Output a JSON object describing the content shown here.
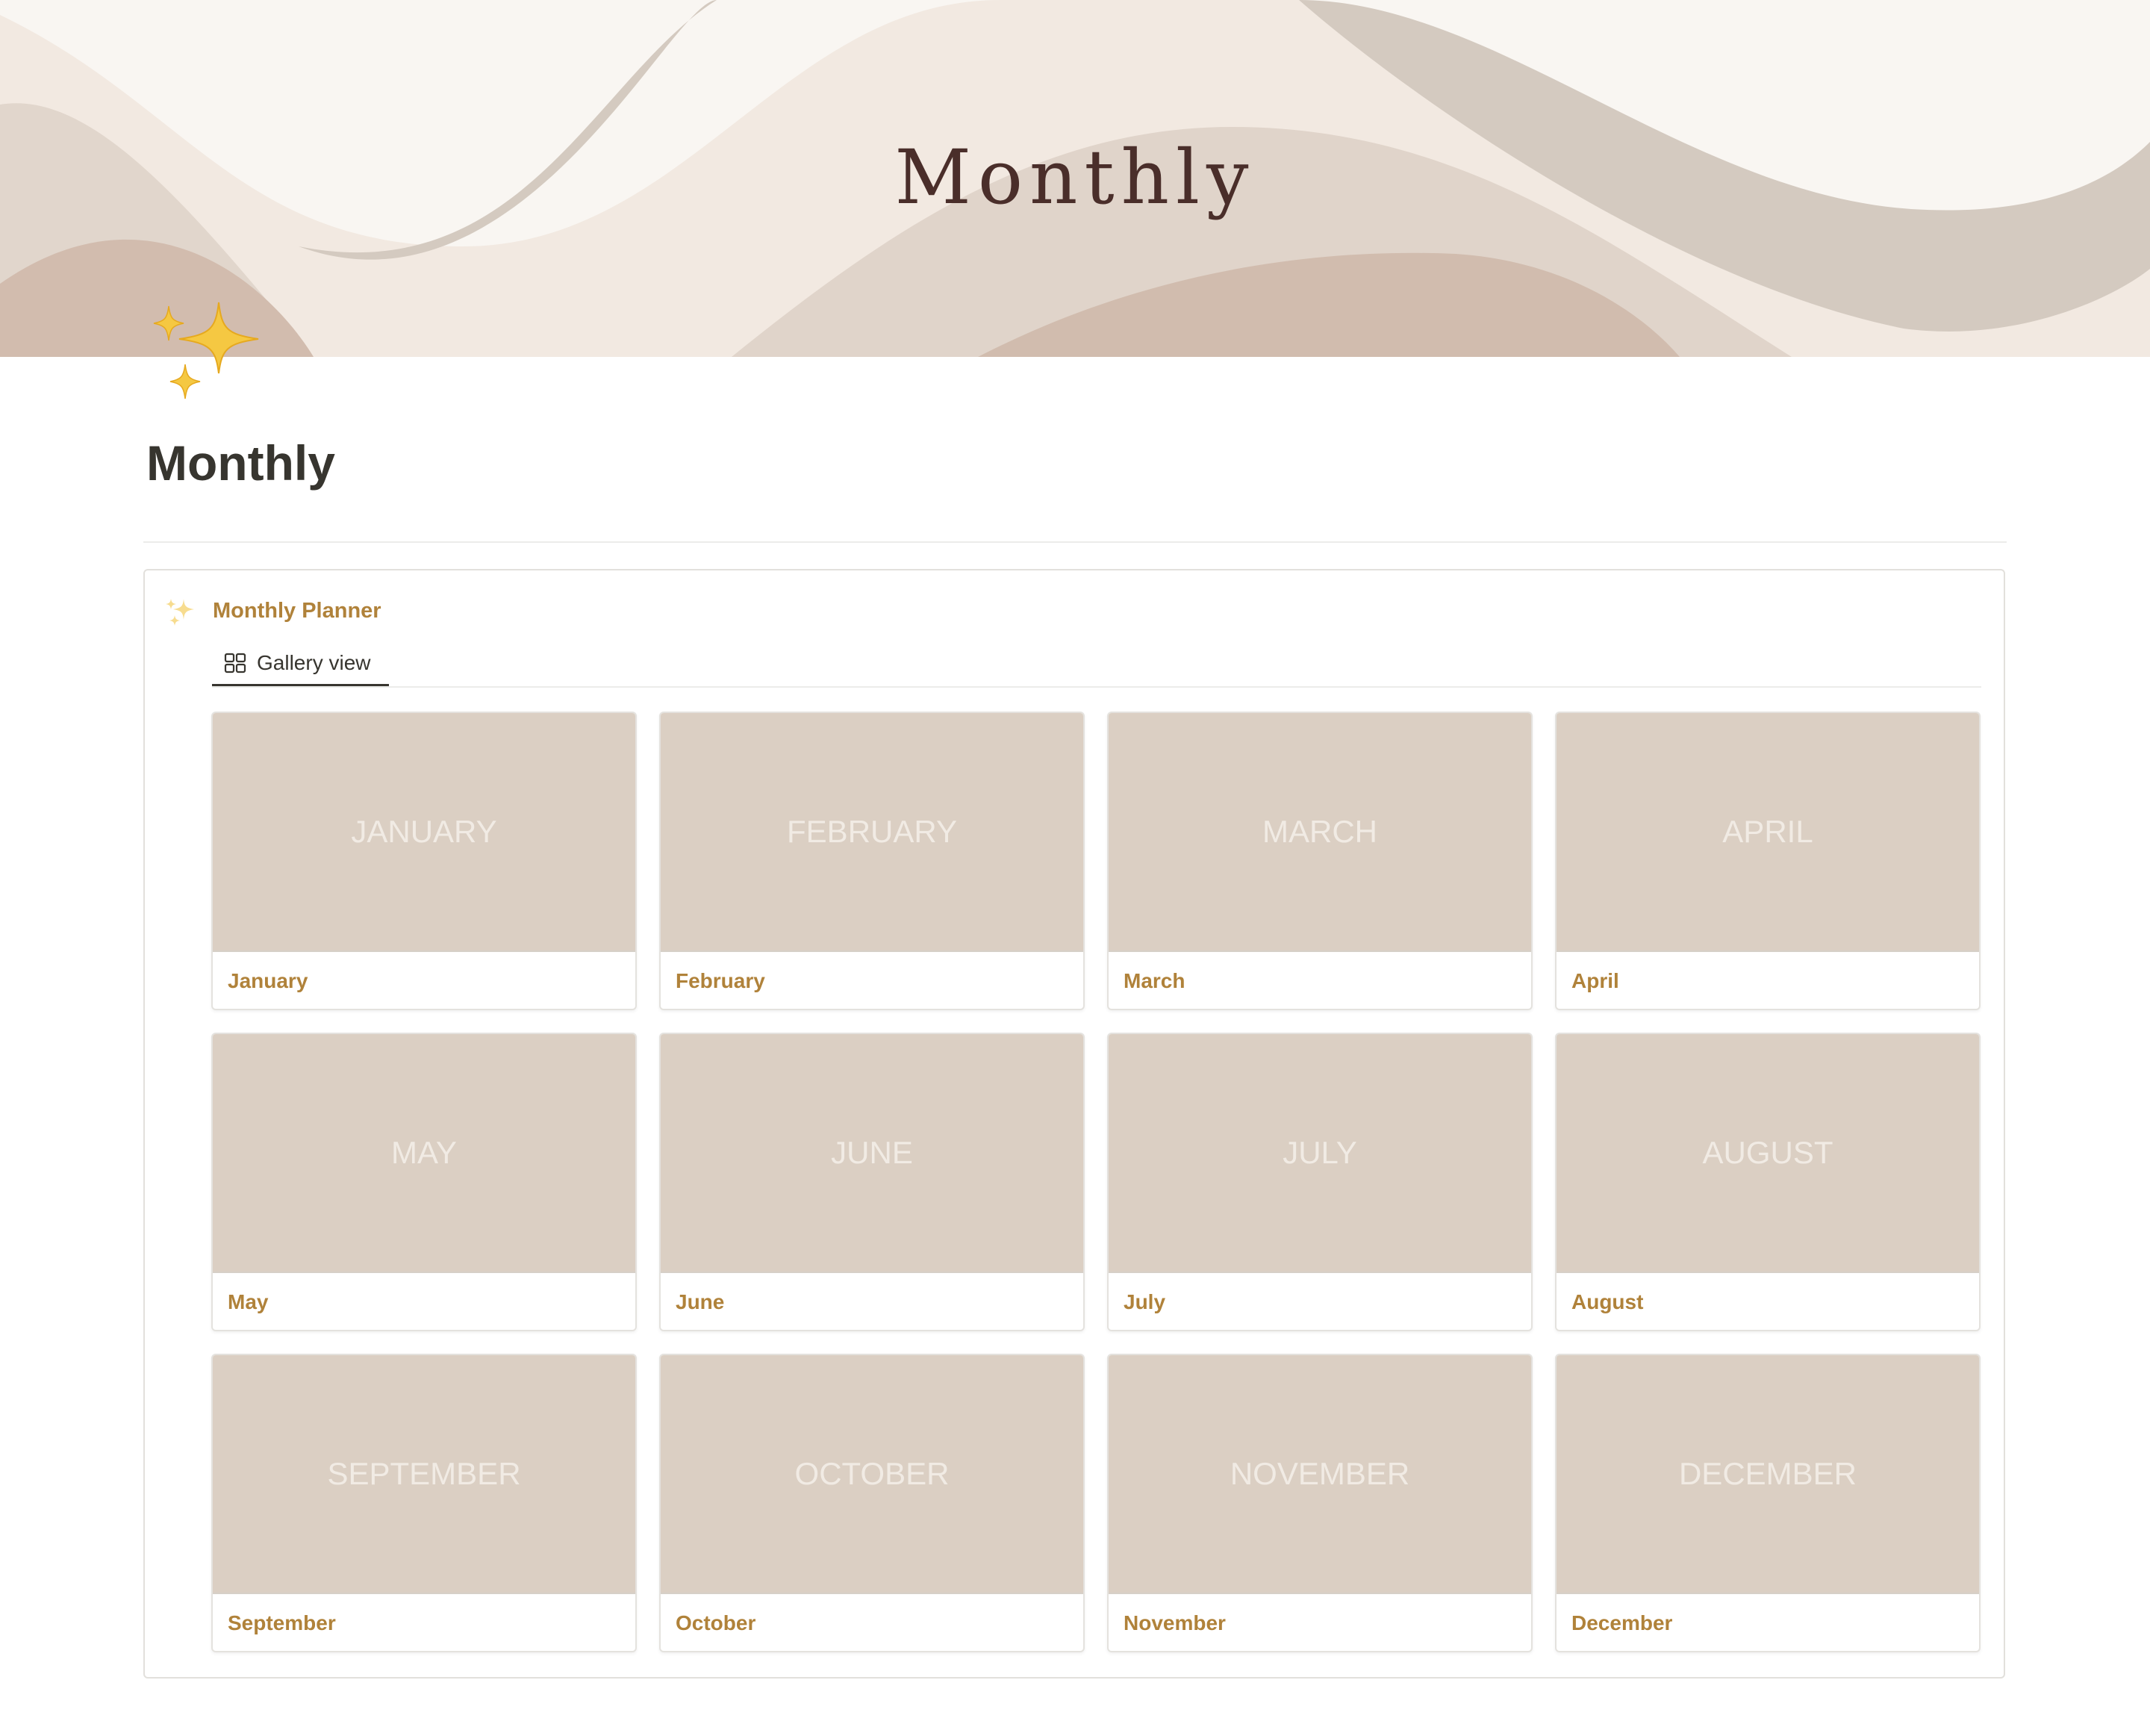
{
  "cover": {
    "title": "Monthly"
  },
  "page": {
    "icon": "sparkles-icon",
    "title": "Monthly"
  },
  "database": {
    "icon": "sparkles-icon",
    "title": "Monthly Planner",
    "view_tab": {
      "icon": "gallery-grid-icon",
      "label": "Gallery view"
    },
    "cards": [
      {
        "cover_text": "JANUARY",
        "name": "January"
      },
      {
        "cover_text": "FEBRUARY",
        "name": "February"
      },
      {
        "cover_text": "MARCH",
        "name": "March"
      },
      {
        "cover_text": "APRIL",
        "name": "April"
      },
      {
        "cover_text": "MAY",
        "name": "May"
      },
      {
        "cover_text": "JUNE",
        "name": "June"
      },
      {
        "cover_text": "JULY",
        "name": "July"
      },
      {
        "cover_text": "AUGUST",
        "name": "August"
      },
      {
        "cover_text": "SEPTEMBER",
        "name": "September"
      },
      {
        "cover_text": "OCTOBER",
        "name": "October"
      },
      {
        "cover_text": "NOVEMBER",
        "name": "November"
      },
      {
        "cover_text": "DECEMBER",
        "name": "December"
      }
    ]
  },
  "colors": {
    "accent_text": "#b0823a",
    "card_cover": "#dbcfc3",
    "cover_title": "#4a2e2a"
  }
}
